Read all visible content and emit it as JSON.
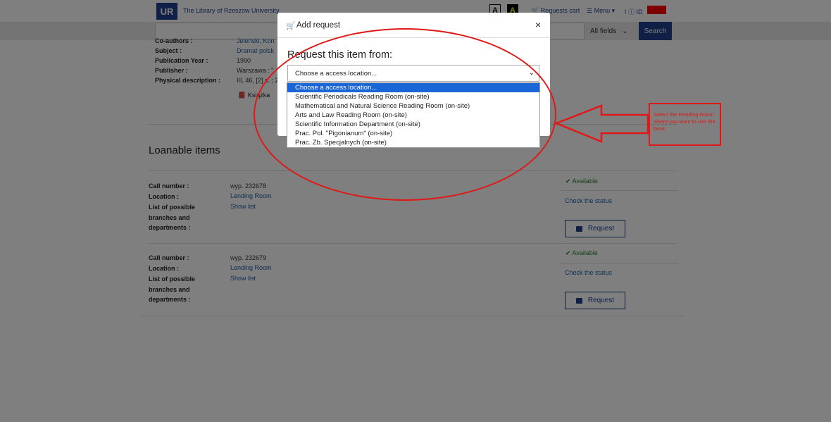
{
  "header": {
    "logo": "UR",
    "library_name": "The Library of Rzeszow University",
    "contrast_a": "A",
    "contrast_b": "A",
    "requests_cart": "Requests cart",
    "menu": "☰ Menu ▾",
    "id_label": "! ⓘ ID"
  },
  "search": {
    "field_select": "All fields",
    "search_button": "Search"
  },
  "record": {
    "coauthors_label": "Co-authors :",
    "coauthors_value": "Jeleński, Kon",
    "subject_label": "Subject :",
    "subject_value": "Dramat polsk",
    "pubyear_label": "Publication Year :",
    "pubyear_value": "1990",
    "publisher_label": "Publisher :",
    "publisher_value": "Warszawa : \"",
    "physdesc_label": "Physical description :",
    "physdesc_value": "III, 46, [2] s. ; 2",
    "format_tag": "Książka"
  },
  "loanable": {
    "title": "Loanable items",
    "labels": {
      "call_number": "Call number :",
      "location": "Location :",
      "branches": "List of possible branches and departments :"
    },
    "items": [
      {
        "call_number": "wyp. 232678",
        "location": "Lending Room",
        "show_list": "Show list",
        "status": "✔ Available",
        "check": "Check the status",
        "request": "Request"
      },
      {
        "call_number": "wyp. 232679",
        "location": "Lending Room",
        "show_list": "Show list",
        "status": "✔ Available",
        "check": "Check the status",
        "request": "Request"
      }
    ]
  },
  "modal": {
    "title": "Add request",
    "close": "×",
    "request_from": "Request this item from:",
    "select_value": "Choose a access location...",
    "options": [
      "Choose a access location...",
      "Scientific Periodicals Reading Room (on-site)",
      "Mathematical and Natural Science Reading Room (on-site)",
      "Arts and Law Reading Room (on-site)",
      "Scientific Information Department (on-site)",
      "Prac. Pol. \"Pigonianum\" (on-site)",
      "Prac. Zb. Specjalnych (on-site)"
    ]
  },
  "annotation": {
    "note": "Select the Reading Room where you want to use the book",
    "color": "#e01818"
  }
}
